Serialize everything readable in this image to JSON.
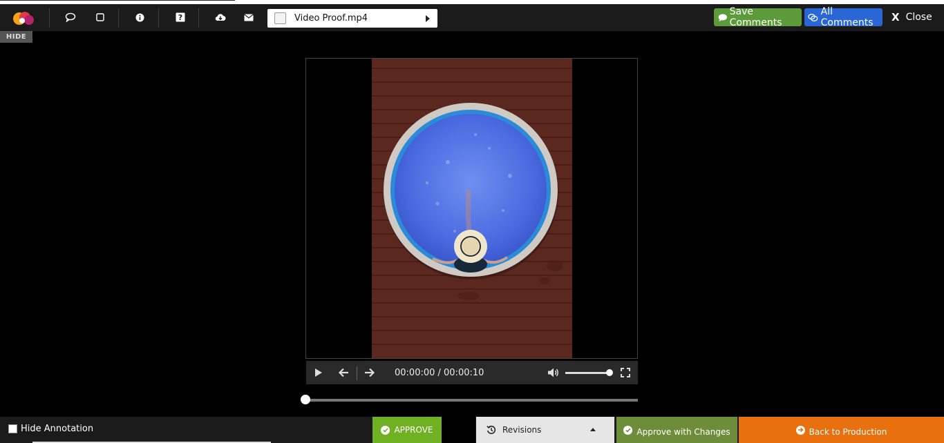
{
  "toolbar": {
    "icons": [
      "comment-bubble-icon",
      "rectangle-icon",
      "info-icon",
      "help-icon",
      "cloud-download-icon",
      "envelope-icon"
    ],
    "file_select": {
      "value": "Video Proof.mp4"
    },
    "save_comments_label": "Save Comments",
    "all_comments_label": "All Comments",
    "close_label": "Close",
    "close_glyph": "X"
  },
  "hide_tag_label": "HIDE",
  "player": {
    "time_display": "00:00:00 / 00:00:10",
    "volume_level": 1.0,
    "seek_position": 0.0
  },
  "bottombar": {
    "hide_annotation_label": "Hide Annotation",
    "approve_label": "APPROVE",
    "revisions_label": "Revisions",
    "approve_changes_label": "Approve with Changes",
    "back_production_label": "Back to Production"
  },
  "colors": {
    "save_green": "#5d9a3a",
    "all_blue": "#2a66d6",
    "approve_green": "#6fb122",
    "approve_changes_green": "#6e8d3b",
    "back_orange": "#e8700f"
  }
}
